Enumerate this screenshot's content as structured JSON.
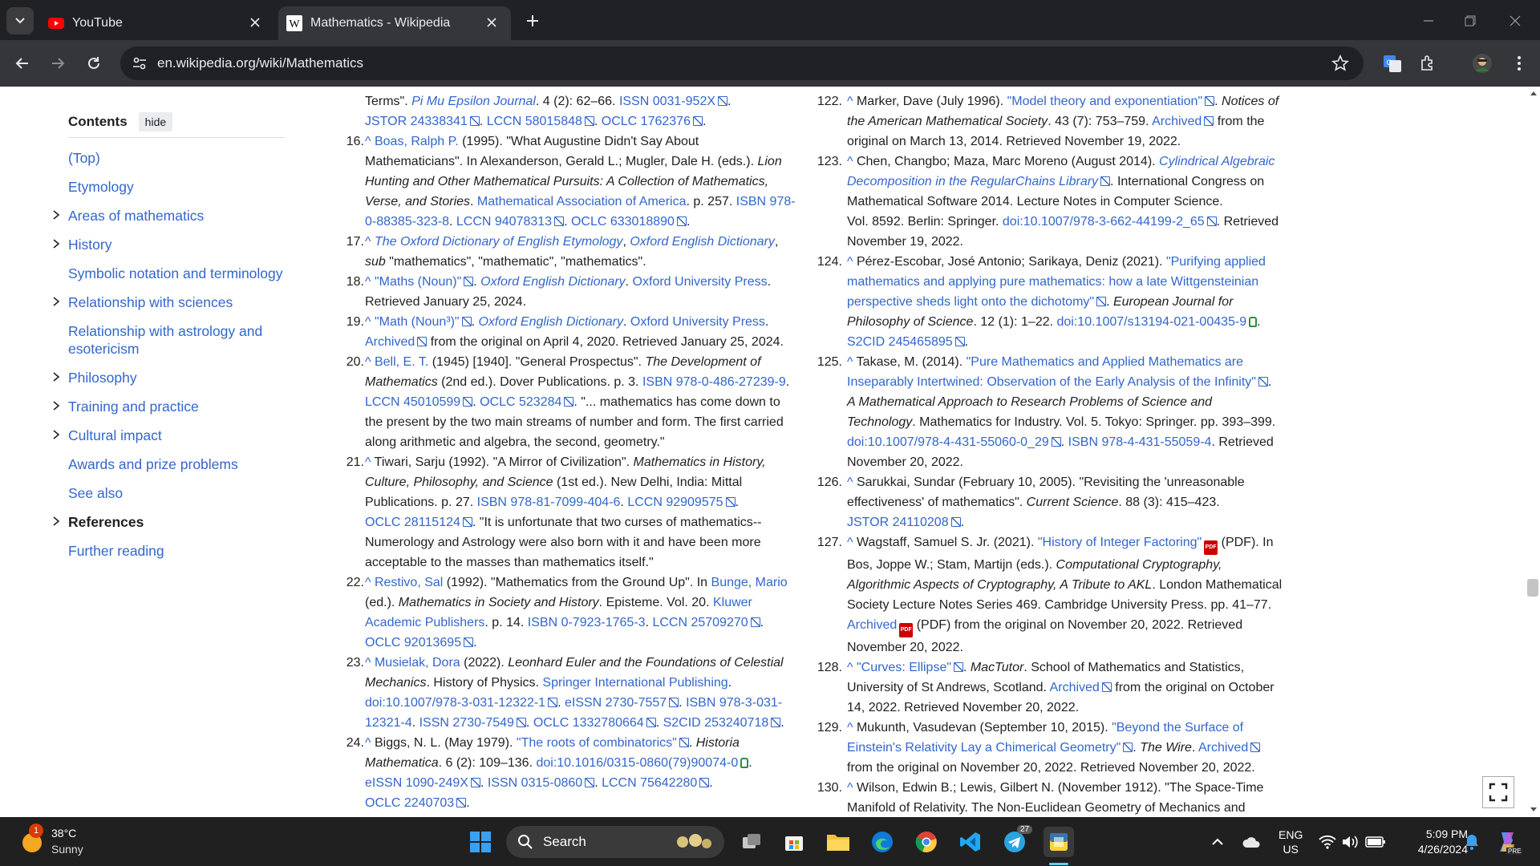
{
  "browser": {
    "tab1": {
      "title": "YouTube"
    },
    "tab2": {
      "title": "Mathematics - Wikipedia"
    },
    "url": "en.wikipedia.org/wiki/Mathematics"
  },
  "toc": {
    "title": "Contents",
    "hide": "hide",
    "items": [
      "(Top)",
      "Etymology",
      "Areas of mathematics",
      "History",
      "Symbolic notation and terminology",
      "Relationship with sciences",
      "Relationship with astrology and esotericism",
      "Philosophy",
      "Training and practice",
      "Cultural impact",
      "Awards and prize problems",
      "See also",
      "References",
      "Further reading"
    ]
  },
  "refs_left": {
    "l0": "Terms\". ",
    "l0b": "Pi Mu Epsilon Journal",
    "l0c": ". 4 (2): 62–66. ",
    "l0d": "ISSN 0031-952X",
    "l1a": "JSTOR 24338341",
    "l1b": "LCCN 58015848",
    "l1c": "OCLC 1762376",
    "n16": "16.",
    "r16a": "Boas, Ralph P.",
    "r16b": " (1995). \"What Augustine Didn't Say About",
    "r16c": "Mathematicians\". In Alexanderson, Gerald L.; Mugler, Dale H. (eds.). ",
    "r16c2": "Lion",
    "r16d": "Hunting and Other Mathematical Pursuits: A Collection of Mathematics,",
    "r16e": "Verse, and Stories",
    "r16e2": ". ",
    "r16e3": "Mathematical Association of America",
    "r16e4": ". p. 257. ",
    "r16e5": "ISBN 978-",
    "r16f": "0-88385-323-8",
    "r16f2": "LCCN 94078313",
    "r16f3": "OCLC 633018890",
    "n17": "17.",
    "r17a": "The Oxford Dictionary of English Etymology",
    "r17b": "Oxford English Dictionary",
    "r17c": "sub",
    "r17d": " \"mathematics\", \"mathematic\", \"mathematics\".",
    "n18": "18.",
    "r18a": "\"Maths (Noun)\"",
    "r18b": "Oxford English Dictionary",
    "r18c": "Oxford University Press",
    "r18d": "Retrieved January 25, 2024.",
    "n19": "19.",
    "r19a": "\"Math (Noun³)\"",
    "r19b": "Oxford English Dictionary",
    "r19c": "Oxford University Press",
    "r19d": "Archived",
    "r19e": " from the original on April 4, 2020. Retrieved January 25, 2024.",
    "n20": "20.",
    "r20a": "Bell, E. T.",
    "r20b": " (1945) [1940]. \"General Prospectus\". ",
    "r20c": "The Development of",
    "r20d": "Mathematics",
    "r20e": " (2nd ed.). Dover Publications. p. 3. ",
    "r20f": "ISBN 978-0-486-27239-9",
    "r20g": "LCCN 45010599",
    "r20h": "OCLC 523284",
    "r20i": ". \"... mathematics has come down to",
    "r20j": "the present by the two main streams of number and form. The first carried",
    "r20k": "along arithmetic and algebra, the second, geometry.\"",
    "n21": "21.",
    "r21a": " Tiwari, Sarju (1992). \"A Mirror of Civilization\". ",
    "r21b": "Mathematics in History,",
    "r21c": "Culture, Philosophy, and Science",
    "r21d": " (1st ed.). New Delhi, India: Mittal",
    "r21e": "Publications. p. 27. ",
    "r21f": "ISBN 978-81-7099-404-6",
    "r21g": "LCCN 92909575",
    "r21h": "OCLC 28115124",
    "r21i": ". \"It is unfortunate that two curses of mathematics--",
    "r21j": "Numerology and Astrology were also born with it and have been more",
    "r21k": "acceptable to the masses than mathematics itself.\"",
    "n22": "22.",
    "r22a": "Restivo, Sal",
    "r22b": " (1992). \"Mathematics from the Ground Up\". In ",
    "r22c": "Bunge, Mario",
    "r22d": "(ed.). ",
    "r22e": "Mathematics in Society and History",
    "r22f": ". Episteme. Vol. 20. ",
    "r22g": "Kluwer",
    "r22h": "Academic Publishers",
    "r22i": ". p. 14. ",
    "r22j": "ISBN 0-7923-1765-3",
    "r22k": "LCCN 25709270",
    "r22l": "OCLC 92013695",
    "n23": "23.",
    "r23a": "Musielak, Dora",
    "r23b": " (2022). ",
    "r23c": "Leonhard Euler and the Foundations of Celestial",
    "r23d": "Mechanics",
    "r23e": ". History of Physics. ",
    "r23f": "Springer International Publishing",
    "r23g": "doi:10.1007/978-3-031-12322-1",
    "r23h": "eISSN 2730-7557",
    "r23i": "ISBN 978-3-031-",
    "r23j": "12321-4",
    "r23k": "ISSN 2730-7549",
    "r23l": "OCLC 1332780664",
    "r23m": "S2CID 253240718",
    "n24": "24.",
    "r24a": " Biggs, N. L. (May 1979). ",
    "r24b": "\"The roots of combinatorics\"",
    "r24c": "Historia",
    "r24d": "Mathematica",
    "r24e": ". 6 (2): 109–136. ",
    "r24f": "doi:10.1016/0315-0860(79)90074-0",
    "r24g": "eISSN 1090-249X",
    "r24h": "ISSN 0315-0860",
    "r24i": "LCCN 75642280",
    "r24j": "OCLC 2240703"
  },
  "refs_right": {
    "n122": "122.",
    "r122a": " Marker, Dave (July 1996). ",
    "r122b": "\"Model theory and exponentiation\"",
    "r122c": "Notices of",
    "r122d": "the American Mathematical Society",
    "r122e": ". 43 (7): 753–759. ",
    "r122f": "Archived",
    "r122g": " from the",
    "r122h": "original on March 13, 2014. Retrieved November 19, 2022.",
    "n123": "123.",
    "r123a": " Chen, Changbo; Maza, Marc Moreno (August 2014). ",
    "r123b": "Cylindrical Algebraic",
    "r123c": "Decomposition in the RegularChains Library",
    "r123d": ". International Congress on",
    "r123e": "Mathematical Software 2014. Lecture Notes in Computer Science.",
    "r123f": "Vol. 8592. Berlin: Springer. ",
    "r123g": "doi:10.1007/978-3-662-44199-2_65",
    "r123h": ". Retrieved",
    "r123i": "November 19, 2022.",
    "n124": "124.",
    "r124a": " Pérez-Escobar, José Antonio; Sarikaya, Deniz (2021). ",
    "r124b": "\"Purifying applied",
    "r124c": "mathematics and applying pure mathematics: how a late Wittgensteinian",
    "r124d": "perspective sheds light onto the dichotomy\"",
    "r124e": "European Journal for",
    "r124f": "Philosophy of Science",
    "r124g": ". 12 (1): 1–22. ",
    "r124h": "doi:10.1007/s13194-021-00435-9",
    "r124i": "S2CID 245465895",
    "n125": "125.",
    "r125a": " Takase, M. (2014). ",
    "r125b": "\"Pure Mathematics and Applied Mathematics are",
    "r125c": "Inseparably Intertwined: Observation of the Early Analysis of the Infinity\"",
    "r125d": "A Mathematical Approach to Research Problems of Science and",
    "r125e": "Technology",
    "r125f": ". Mathematics for Industry. Vol. 5. Tokyo: Springer. pp. 393–399.",
    "r125g": "doi:10.1007/978-4-431-55060-0_29",
    "r125h": "ISBN 978-4-431-55059-4",
    "r125i": ". Retrieved",
    "r125j": "November 20, 2022.",
    "n126": "126.",
    "r126a": " Sarukkai, Sundar (February 10, 2005). \"Revisiting the 'unreasonable",
    "r126b": "effectiveness' of mathematics\". ",
    "r126c": "Current Science",
    "r126d": ". 88 (3): 415–423.",
    "r126e": "JSTOR 24110208",
    "n127": "127.",
    "r127a": " Wagstaff, Samuel S. Jr. (2021). ",
    "r127b": "\"History of Integer Factoring\"",
    "r127c": " (PDF). In",
    "r127d": "Bos, Joppe W.; Stam, Martijn (eds.). ",
    "r127e": "Computational Cryptography,",
    "r127f": "Algorithmic Aspects of Cryptography, A Tribute to AKL",
    "r127g": ". London Mathematical",
    "r127h": "Society Lecture Notes Series 469. Cambridge University Press. pp. 41–77.",
    "r127i": "Archived",
    "r127j": " (PDF) from the original on November 20, 2022. Retrieved",
    "r127k": "November 20, 2022.",
    "n128": "128.",
    "r128a": "\"Curves: Ellipse\"",
    "r128b": "MacTutor",
    "r128c": ". School of Mathematics and Statistics,",
    "r128d": "University of St Andrews, Scotland. ",
    "r128e": "Archived",
    "r128f": " from the original on October",
    "r128g": "14, 2022. Retrieved November 20, 2022.",
    "n129": "129.",
    "r129a": " Mukunth, Vasudevan (September 10, 2015). ",
    "r129b": "\"Beyond the Surface of",
    "r129c": "Einstein's Relativity Lay a Chimerical Geometry\"",
    "r129d": "The Wire",
    "r129e": "Archived",
    "r129f": "from the original on November 20, 2022. Retrieved November 20, 2022.",
    "n130": "130.",
    "r130a": " Wilson, Edwin B.; Lewis, Gilbert N. (November 1912). \"The Space-Time",
    "r130b": "Manifold of Relativity. The Non-Euclidean Geometry of Mechanics and"
  },
  "pdf_label": "PDF",
  "taskbar": {
    "weather_temp": "38°C",
    "weather_desc": "Sunny",
    "weather_badge": "1",
    "search": "Search",
    "lang1": "ENG",
    "lang2": "US",
    "time": "5:09 PM",
    "date": "4/26/2024",
    "telegram_badge": "27",
    "pre_badge": "PRE"
  },
  "colors": {
    "link": "#3366cc",
    "text": "#202122",
    "chrome_dark": "#202124",
    "chrome_toolbar": "#35363a",
    "taskbar": "#202020"
  }
}
